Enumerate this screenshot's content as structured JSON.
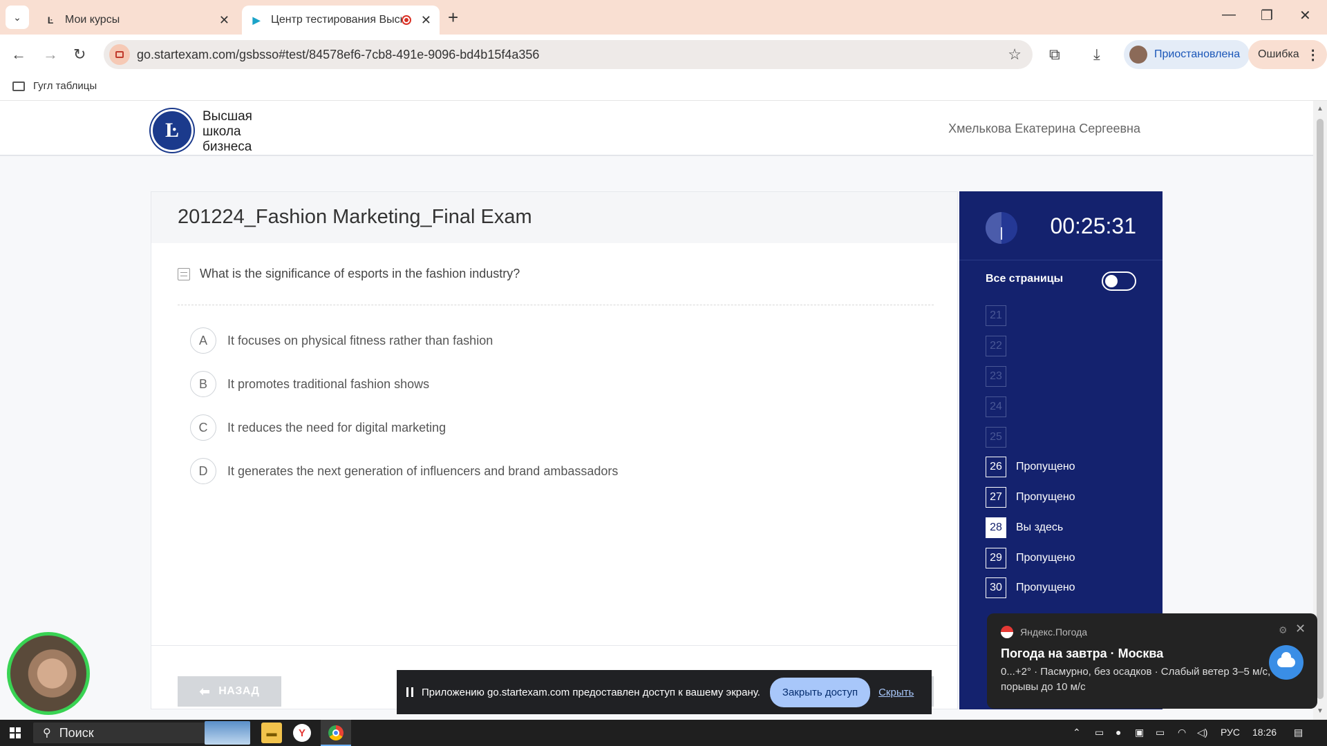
{
  "browser": {
    "tabs": [
      {
        "title": "Мои курсы"
      },
      {
        "title": "Центр тестирования Высш"
      }
    ],
    "url": "go.startexam.com/gsbsso#test/84578ef6-7cb8-491e-9096-bd4b15f4a356",
    "profile_status": "Приостановлена",
    "error_label": "Ошибка",
    "bookmarks": [
      {
        "label": "Гугл таблицы"
      }
    ]
  },
  "header": {
    "logo_lines": [
      "Высшая",
      "школа",
      "бизнеса"
    ],
    "user_name": "Хмелькова Екатерина Сергеевна"
  },
  "exam": {
    "title": "201224_Fashion Marketing_Final Exam",
    "question": "What is the significance of esports in the fashion industry?",
    "options": [
      {
        "letter": "A",
        "text": "It focuses on physical fitness rather than fashion"
      },
      {
        "letter": "B",
        "text": "It promotes traditional fashion shows"
      },
      {
        "letter": "C",
        "text": "It reduces the need for digital marketing"
      },
      {
        "letter": "D",
        "text": "It generates the next generation of influencers and brand ambassadors"
      }
    ],
    "back_label": "НАЗАД"
  },
  "sidebar": {
    "timer": "00:25:31",
    "all_pages_label": "Все страницы",
    "pages": [
      {
        "num": "21",
        "status": ""
      },
      {
        "num": "22",
        "status": ""
      },
      {
        "num": "23",
        "status": ""
      },
      {
        "num": "24",
        "status": ""
      },
      {
        "num": "25",
        "status": ""
      },
      {
        "num": "26",
        "status": "Пропущено"
      },
      {
        "num": "27",
        "status": "Пропущено"
      },
      {
        "num": "28",
        "status": "Вы здесь"
      },
      {
        "num": "29",
        "status": "Пропущено"
      },
      {
        "num": "30",
        "status": "Пропущено"
      }
    ]
  },
  "notification": {
    "source": "Яндекс.Погода",
    "title": "Погода на завтра · Москва",
    "body": "0...+2° · Пасмурно, без осадков · Слабый ветер 3–5 м/с, порывы до 10 м/с"
  },
  "share_bar": {
    "message": "Приложению go.startexam.com предоставлен доступ к вашему экрану.",
    "stop_label": "Закрыть доступ",
    "hide_label": "Скрыть"
  },
  "taskbar": {
    "search_label": "Поиск",
    "language": "РУС",
    "time": "18:26"
  },
  "colors": {
    "sidebar_bg": "#14226e",
    "tabstrip_bg": "#f9dfd2",
    "webcam_ring": "#39d353"
  }
}
